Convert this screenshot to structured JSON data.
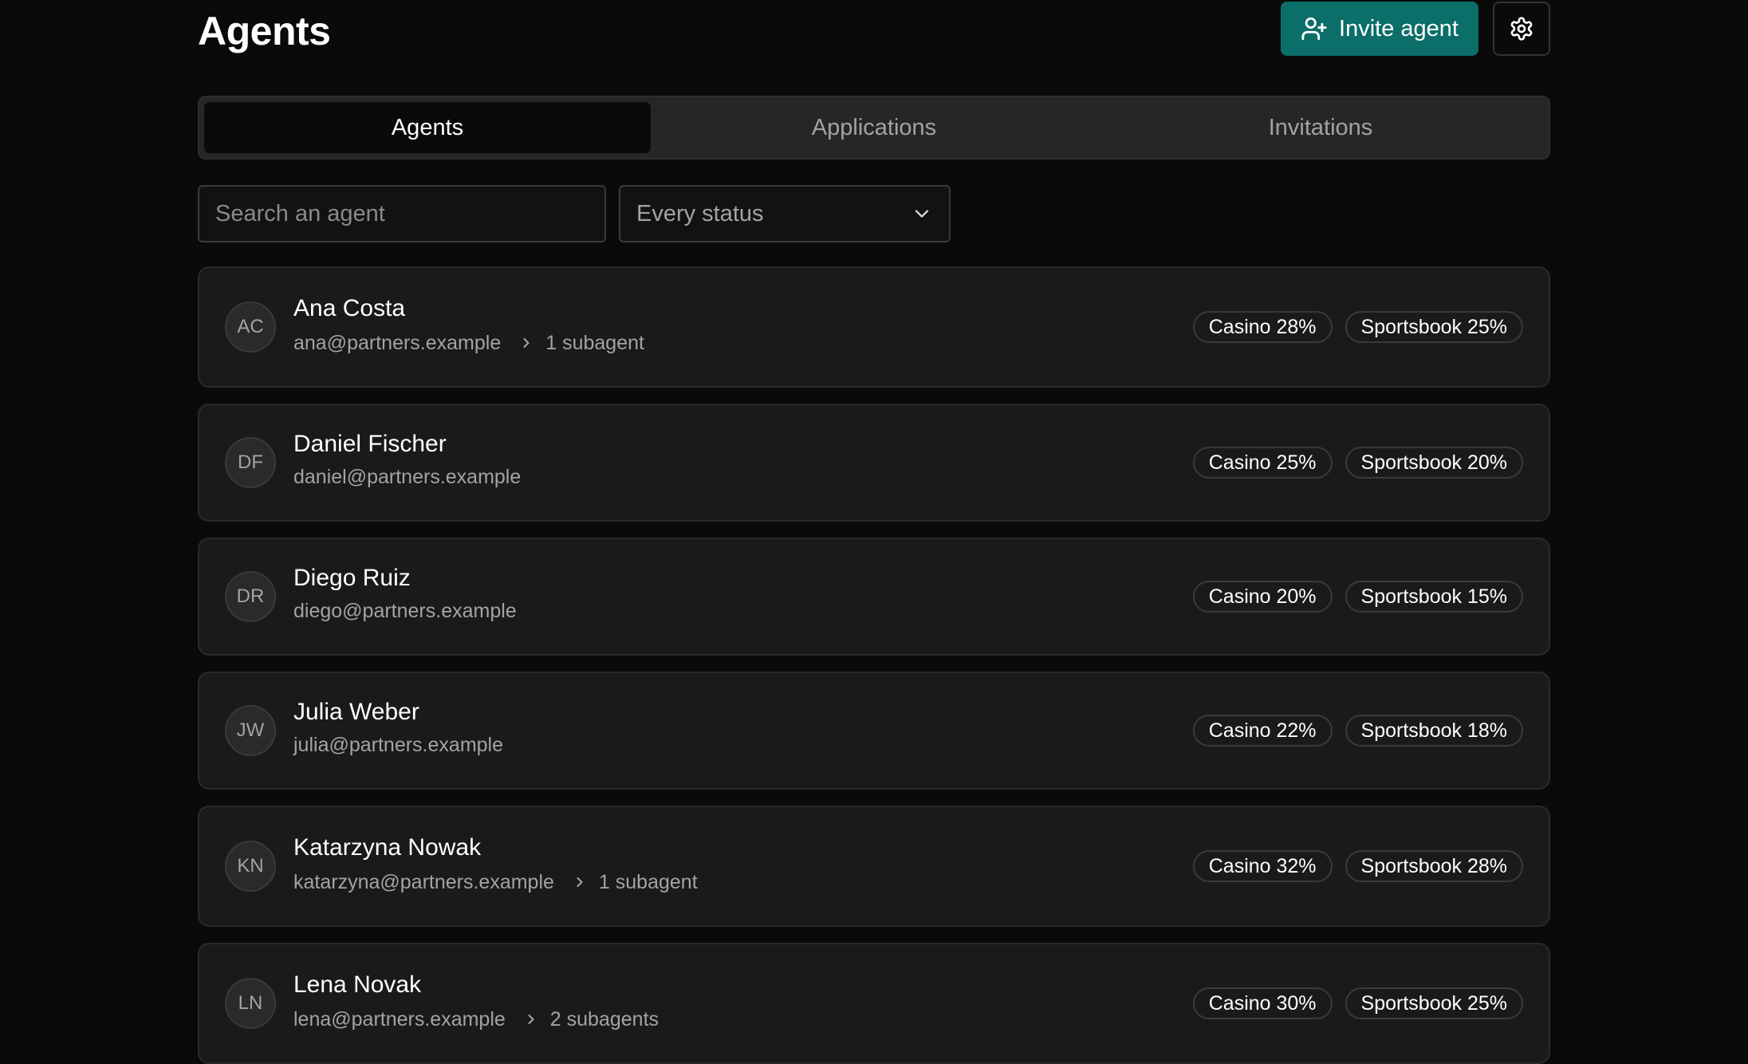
{
  "header": {
    "title": "Agents",
    "invite_label": "Invite agent"
  },
  "tabs": [
    {
      "label": "Agents",
      "active": true
    },
    {
      "label": "Applications",
      "active": false
    },
    {
      "label": "Invitations",
      "active": false
    }
  ],
  "filters": {
    "search_placeholder": "Search an agent",
    "status_value": "Every status"
  },
  "agents": [
    {
      "initials": "AC",
      "name": "Ana Costa",
      "email": "ana@partners.example",
      "subagents": "1 subagent",
      "casino": "Casino 28%",
      "sportsbook": "Sportsbook 25%"
    },
    {
      "initials": "DF",
      "name": "Daniel Fischer",
      "email": "daniel@partners.example",
      "subagents": "",
      "casino": "Casino 25%",
      "sportsbook": "Sportsbook 20%"
    },
    {
      "initials": "DR",
      "name": "Diego Ruiz",
      "email": "diego@partners.example",
      "subagents": "",
      "casino": "Casino 20%",
      "sportsbook": "Sportsbook 15%"
    },
    {
      "initials": "JW",
      "name": "Julia Weber",
      "email": "julia@partners.example",
      "subagents": "",
      "casino": "Casino 22%",
      "sportsbook": "Sportsbook 18%"
    },
    {
      "initials": "KN",
      "name": "Katarzyna Nowak",
      "email": "katarzyna@partners.example",
      "subagents": "1 subagent",
      "casino": "Casino 32%",
      "sportsbook": "Sportsbook 28%"
    },
    {
      "initials": "LN",
      "name": "Lena Novak",
      "email": "lena@partners.example",
      "subagents": "2 subagents",
      "casino": "Casino 30%",
      "sportsbook": "Sportsbook 25%"
    }
  ],
  "colors": {
    "background": "#0a0a0a",
    "accent": "#0b6e68",
    "card": "#1a1a1a",
    "muted_text": "#a3a3a3"
  },
  "icons": {
    "invite": "user-plus-icon",
    "settings": "gear-icon",
    "dropdown": "chevron-down-icon",
    "subagent": "chevron-right-icon"
  }
}
